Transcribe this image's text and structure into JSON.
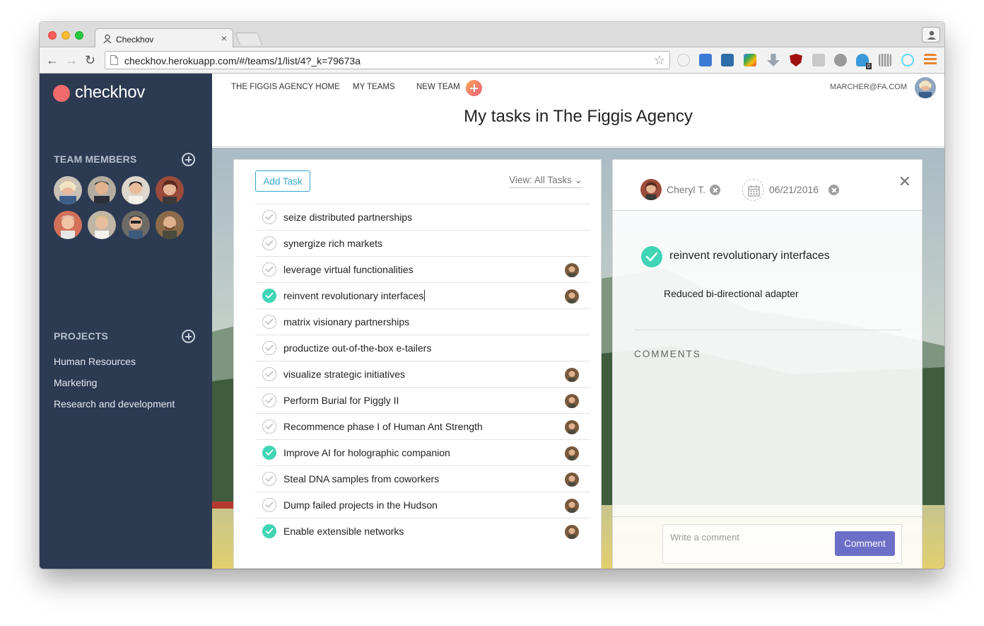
{
  "browser": {
    "tab_title": "Checkhov",
    "tab_close": "×",
    "url": "checkhov.herokuapp.com/#/teams/1/list/4?_k=79673a",
    "back": "←",
    "forward": "→",
    "reload": "↻",
    "bookmark": "☆",
    "extension_badge": "0"
  },
  "sidebar": {
    "logo": "checkhov",
    "team_members_heading": "TEAM MEMBERS",
    "projects_heading": "PROJECTS",
    "projects": [
      "Human Resources",
      "Marketing",
      "Research and development"
    ],
    "colors": {
      "background": "#2c3a52",
      "logo_dot": "#f26b6b"
    }
  },
  "nav": {
    "home": "THE FIGGIS AGENCY HOME",
    "my_teams": "MY TEAMS",
    "new_team": "NEW TEAM",
    "user_email": "MARCHER@FA.COM"
  },
  "page_title": "My tasks in The Figgis Agency",
  "tasks_panel": {
    "add_task": "Add Task",
    "view_filter": "View: All Tasks ⌄",
    "tasks": [
      {
        "title": "seize distributed partnerships",
        "done": false,
        "assignee": false
      },
      {
        "title": "synergize rich markets",
        "done": false,
        "assignee": false
      },
      {
        "title": "leverage virtual functionalities",
        "done": false,
        "assignee": true
      },
      {
        "title": "reinvent revolutionary interfaces",
        "done": true,
        "assignee": true,
        "selected": true
      },
      {
        "title": "matrix visionary partnerships",
        "done": false,
        "assignee": false
      },
      {
        "title": "productize out-of-the-box e-tailers",
        "done": false,
        "assignee": false
      },
      {
        "title": "visualize strategic initiatives",
        "done": false,
        "assignee": true
      },
      {
        "title": "Perform Burial for Piggly II",
        "done": false,
        "assignee": true
      },
      {
        "title": "Recommence phase I of Human Ant Strength",
        "done": false,
        "assignee": true
      },
      {
        "title": "Improve AI for holographic companion",
        "done": true,
        "assignee": true
      },
      {
        "title": "Steal DNA samples from coworkers",
        "done": false,
        "assignee": true
      },
      {
        "title": "Dump failed projects in the Hudson",
        "done": false,
        "assignee": true
      },
      {
        "title": "Enable extensible networks",
        "done": true,
        "assignee": true
      }
    ],
    "colors": {
      "accent": "#31a7cc",
      "done_check": "#3fd5b5"
    }
  },
  "detail": {
    "assignee_name": "Cheryl T.",
    "due_date": "06/21/2016",
    "close": "✕",
    "task_title": "reinvent revolutionary interfaces",
    "description": "Reduced bi-directional adapter",
    "comments_heading": "COMMENTS",
    "comment_placeholder": "Write a comment",
    "comment_button": "Comment",
    "colors": {
      "comment_button": "#6c6fc7"
    }
  }
}
